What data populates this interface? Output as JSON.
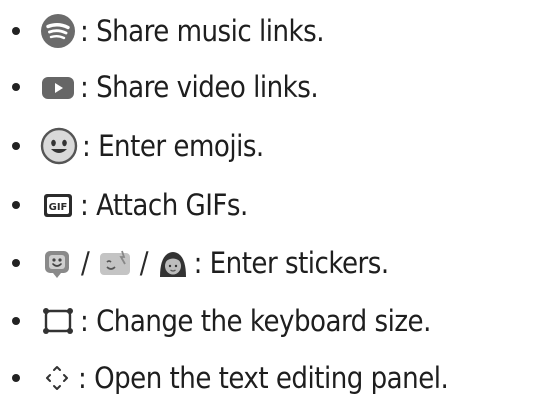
{
  "items": [
    {
      "icons": [
        "spotify-icon"
      ],
      "text": ": Share music links."
    },
    {
      "icons": [
        "youtube-icon"
      ],
      "text": ": Share video links."
    },
    {
      "icons": [
        "emoji-face-icon"
      ],
      "text": ": Enter emojis."
    },
    {
      "icons": [
        "gif-icon"
      ],
      "text": ": Attach GIFs."
    },
    {
      "icons": [
        "sticker-icon",
        "bitmoji-sticker-icon",
        "avatar-sticker-icon"
      ],
      "separator": "/",
      "text": ": Enter stickers."
    },
    {
      "icons": [
        "keyboard-resize-icon"
      ],
      "text": ": Change the keyboard size."
    },
    {
      "icons": [
        "text-cursor-panel-icon"
      ],
      "text": ": Open the text editing panel."
    }
  ]
}
